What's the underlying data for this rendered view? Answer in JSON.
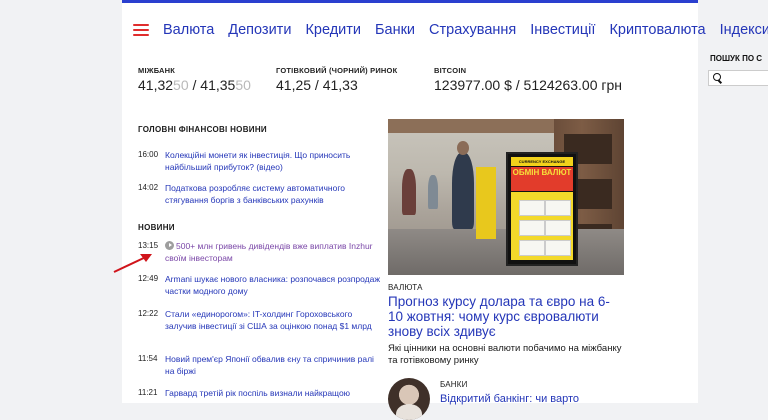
{
  "nav": {
    "items": [
      "Валюта",
      "Депозити",
      "Кредити",
      "Банки",
      "Страхування",
      "Інвестиції",
      "Криптовалюта",
      "Індекси"
    ]
  },
  "rates": [
    {
      "label": "МІЖБАНК",
      "buy": "41,32",
      "buy_dim": "50",
      "sep": " / ",
      "sell": "41,35",
      "sell_dim": "50"
    },
    {
      "label": "ГОТІВКОВИЙ (ЧОРНИЙ) РИНОК",
      "buy": "41,25",
      "buy_dim": "",
      "sep": " / ",
      "sell": "41,33",
      "sell_dim": ""
    },
    {
      "label": "BITCOIN",
      "buy": "123977.00 $",
      "buy_dim": "",
      "sep": " / ",
      "sell": "5124263.00 грн",
      "sell_dim": ""
    }
  ],
  "search": {
    "label": "ПОШУК ПО С",
    "placeholder": ""
  },
  "main_news": {
    "heading": "ГОЛОВНІ ФІНАНСОВІ НОВИНИ",
    "items": [
      {
        "time": "16:00",
        "text": "Колекційні монети як інвестиція. Що приносить найбільший прибуток? (відео)"
      },
      {
        "time": "14:02",
        "text": "Податкова розробляє систему автоматичного стягування боргів з банківських рахунків"
      }
    ]
  },
  "news": {
    "heading": "НОВИНИ",
    "items": [
      {
        "time": "13:15",
        "text": "500+ млн гривень дивідендів вже виплатив Inzhur своїм інвесторам",
        "visited": true
      },
      {
        "time": "12:49",
        "text": "Armani шукає нового власника: розпочався розпродаж частки модного дому",
        "visited": false
      },
      {
        "time": "12:22",
        "text": "Стали «единорогом»: IT-холдинг Гороховського залучив інвестиції зі США за оцінкою понад $1 млрд",
        "visited": false
      },
      {
        "time": "11:54",
        "text": "Новий прем'єр Японії обвалив єну та спричинив ралі на біржі",
        "visited": false
      },
      {
        "time": "11:21",
        "text": "Гарвард третій рік поспіль визнали найкращою",
        "visited": false
      }
    ]
  },
  "photo": {
    "sign_head": "CURRENCY EXCHANGE",
    "sign_title": "ОБМІН ВАЛЮТ"
  },
  "featured": {
    "category": "ВАЛЮТА",
    "title": "Прогноз курсу долара та євро на 6-10 жовтня: чому курс євровалюти знову всіх здивує",
    "subtitle": "Які цінники на основні валюти побачимо на міжбанку та готівковому ринку"
  },
  "secondary": {
    "category": "БАНКИ",
    "title": "Відкритий банкінг: чи варто"
  },
  "colors": {
    "link": "#2436b8",
    "visited": "#7b48a8",
    "accent_red": "#e02d2d",
    "nav_border": "#2a3fcf"
  }
}
